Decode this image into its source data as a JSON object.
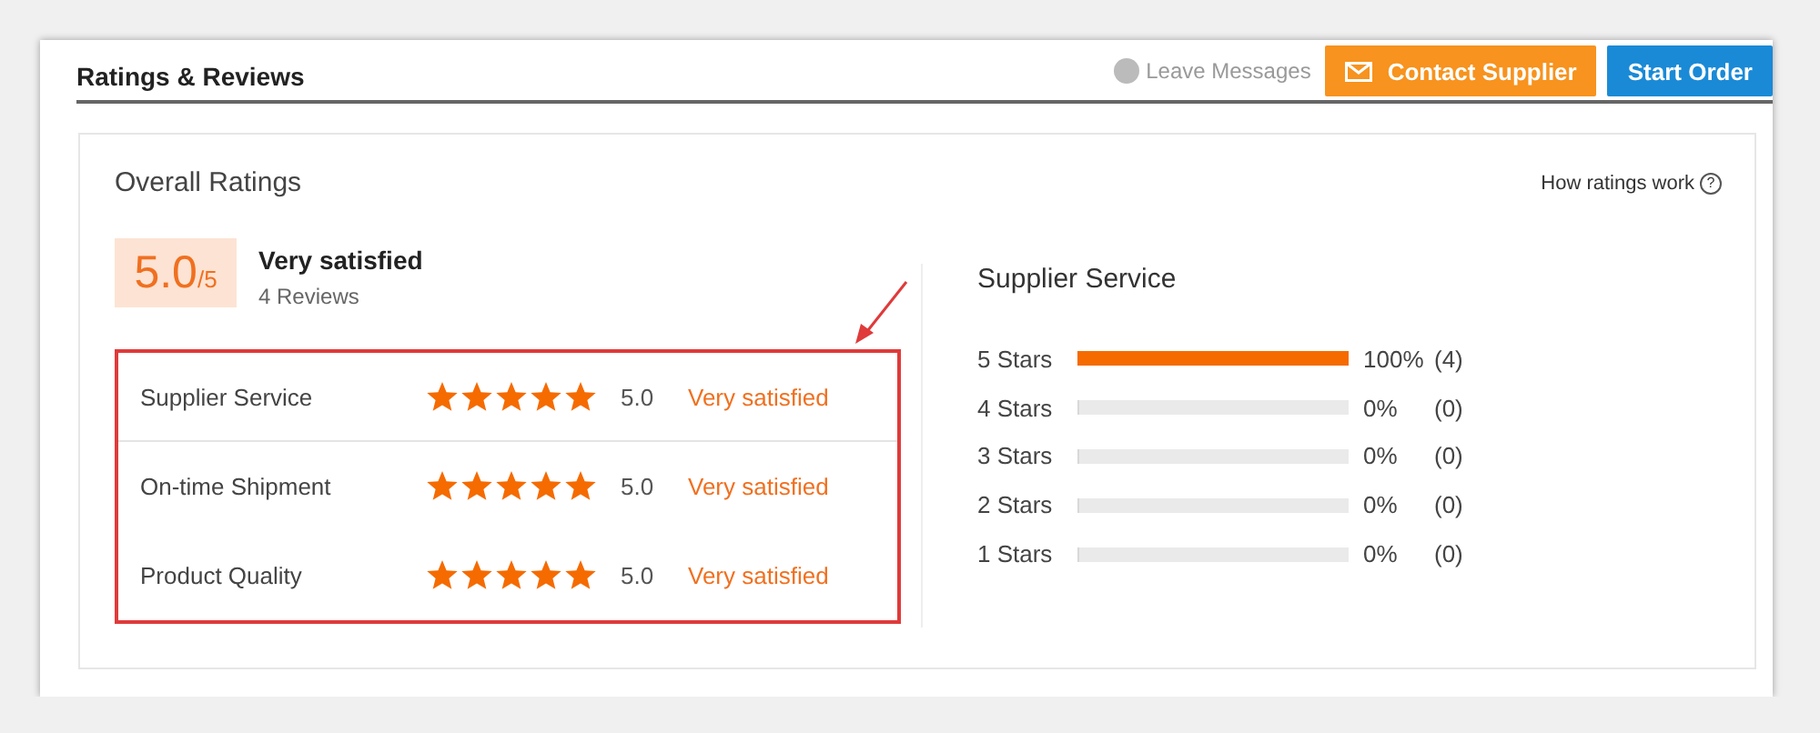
{
  "header": {
    "title": "Ratings & Reviews",
    "leave_messages": "Leave Messages",
    "contact_button": "Contact Supplier",
    "order_button": "Start Order"
  },
  "overall": {
    "title": "Overall Ratings",
    "help_link": "How ratings work",
    "help_icon": "?",
    "score": "5.0",
    "score_max": "/5",
    "verdict": "Very satisfied",
    "reviews": "4 Reviews"
  },
  "categories": [
    {
      "label": "Supplier Service",
      "stars": 5,
      "value": "5.0",
      "verdict": "Very satisfied"
    },
    {
      "label": "On-time Shipment",
      "stars": 5,
      "value": "5.0",
      "verdict": "Very satisfied"
    },
    {
      "label": "Product Quality",
      "stars": 5,
      "value": "5.0",
      "verdict": "Very satisfied"
    }
  ],
  "breakdown": {
    "title": "Supplier Service",
    "rows": [
      {
        "label": "5 Stars",
        "level": 1,
        "percent": "100%",
        "count": "(4)"
      },
      {
        "label": "4 Stars",
        "level": 0,
        "percent": "0%",
        "count": "(0)"
      },
      {
        "label": "3 Stars",
        "level": 0,
        "percent": "0%",
        "count": "(0)"
      },
      {
        "label": "2 Stars",
        "level": 0,
        "percent": "0%",
        "count": "(0)"
      },
      {
        "label": "1 Stars",
        "level": 0,
        "percent": "0%",
        "count": "(0)"
      }
    ]
  }
}
